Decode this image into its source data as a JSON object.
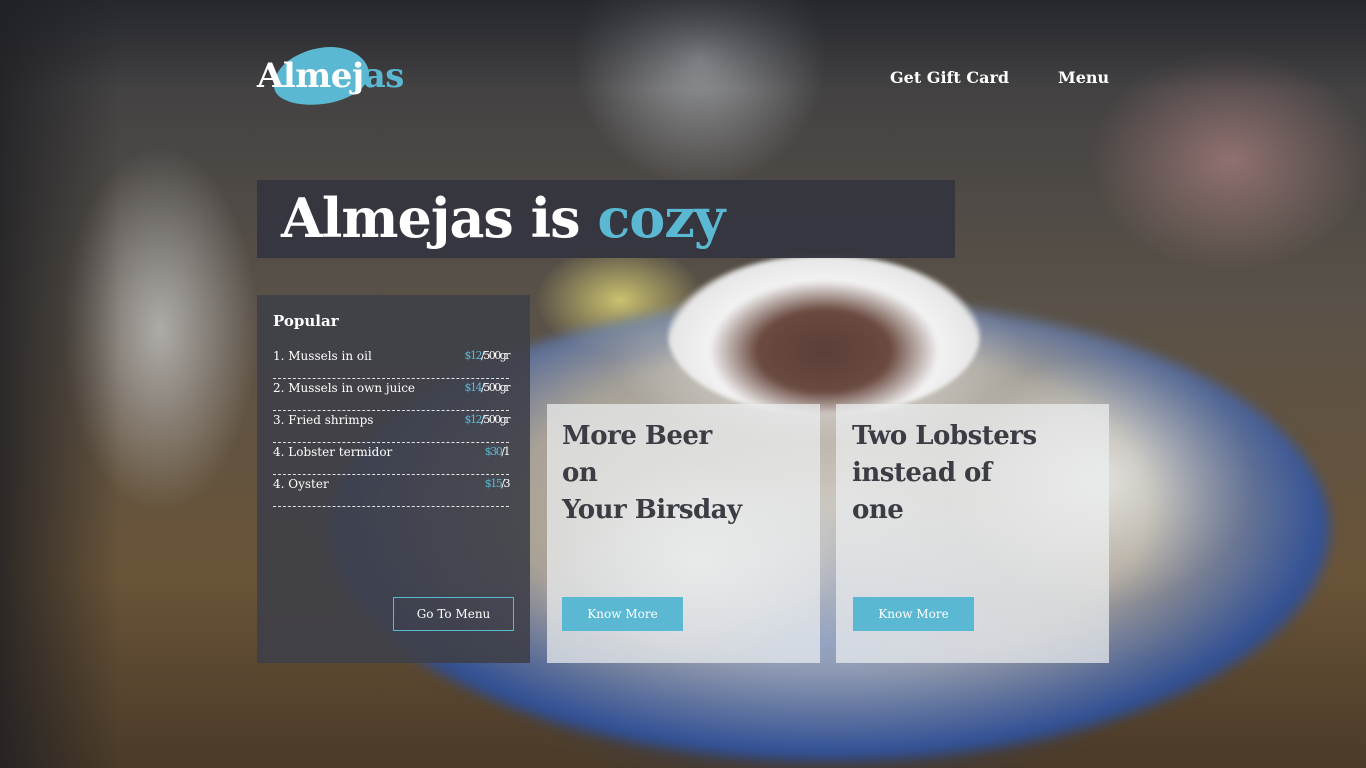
{
  "brand": {
    "logo_text_main": "Almej",
    "logo_text_tail": "as",
    "accent_color": "#5bb8d2"
  },
  "nav": {
    "gift_card": "Get Gift Card",
    "menu": "Menu"
  },
  "hero": {
    "title_main": "Almejas is ",
    "title_accent": "cozy"
  },
  "popular": {
    "title": "Popular",
    "items": [
      {
        "name": "1. Mussels in oil",
        "currency": "$12",
        "price": "/500gr"
      },
      {
        "name": "2. Mussels in own juice",
        "currency": "$14",
        "price": "/500gr"
      },
      {
        "name": "3. Fried shrimps",
        "currency": "$12",
        "price": "/500gr"
      },
      {
        "name": "4. Lobster termidor",
        "currency": "$30",
        "price": "/1"
      },
      {
        "name": "4. Oyster",
        "currency": "$15",
        "price": "/3"
      }
    ],
    "button": "Go To Menu"
  },
  "promos": [
    {
      "title": "More Beer\non\nYour Birsday",
      "button": "Know More"
    },
    {
      "title": "Two Lobsters\ninstead of\none",
      "button": "Know More"
    }
  ]
}
